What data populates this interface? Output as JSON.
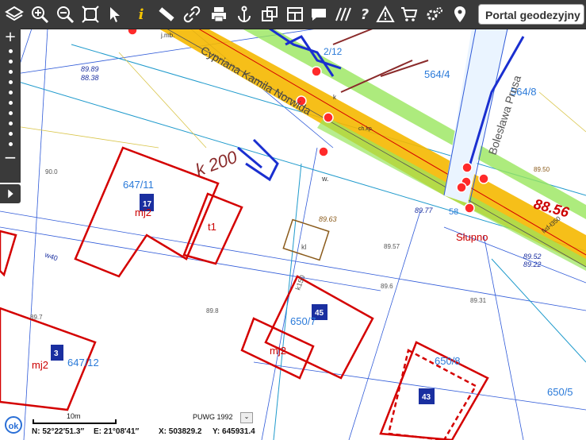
{
  "toolbar": {
    "portal_title": "Portal geodezyjny",
    "tools": [
      "layers-icon",
      "zoom-in-icon",
      "zoom-out-icon",
      "zoom-extent-icon",
      "select-arrow-icon",
      "info-icon",
      "measure-ruler-icon",
      "link-chain-icon",
      "print-icon",
      "anchor-icon",
      "copy-icon",
      "layout-icon",
      "comment-bubble-icon",
      "hatch-icon",
      "help-icon",
      "warning-icon",
      "cart-icon",
      "settings-icon",
      "location-pin-icon"
    ]
  },
  "map": {
    "parcels": [
      "647/11",
      "647/12",
      "650/7",
      "650/8",
      "650/5",
      "564/4",
      "564/8"
    ],
    "building_labels": [
      "mj2",
      "t1",
      "mj2",
      "mj2"
    ],
    "building_numbers": [
      "17",
      "3",
      "45",
      "43"
    ],
    "street_names": [
      "Cypriana Kamila Norwida",
      "Bolesława Prusa"
    ],
    "street_number": "2/12",
    "elevations": [
      "89.89",
      "88.38",
      "89.63",
      "89.77",
      "89.57",
      "89.6",
      "89.52",
      "89.22",
      "89.31",
      "89.50",
      "89.8",
      "89.7",
      "90.0"
    ],
    "utility_labels": [
      "w40",
      "kl",
      "k150",
      "w.",
      "ch.kp.",
      "k",
      "j.mb.",
      "lkd-ł350"
    ],
    "handwritten": [
      "k 200",
      "88.56"
    ],
    "pole_label": "Słupno",
    "pole_number": "58"
  },
  "footer": {
    "ok_label": "ok",
    "scale_label": "10m",
    "crs_label": "PUWG 1992",
    "crs_dropdown": "⌄",
    "lat": "N: 52°22′51.3″",
    "lon": "E: 21°08′41″",
    "x_coord": "X: 503829.2",
    "y_coord": "Y: 645931.4"
  },
  "colors": {
    "toolbar": "#3a3a3a",
    "parcel": "#d40000",
    "parcel_label": "#2a7ad9",
    "road": "#f5b800",
    "green": "#99e65c",
    "utility": "#2f5ad8"
  }
}
